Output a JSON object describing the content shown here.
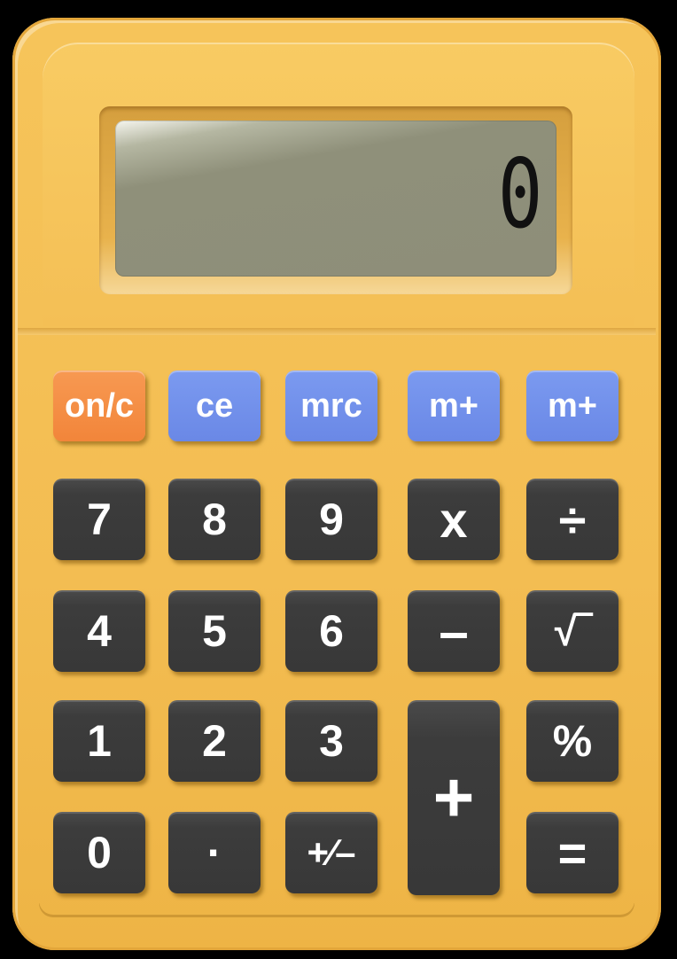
{
  "display": {
    "value": "0"
  },
  "function_keys": {
    "on_c": "on/c",
    "ce": "ce",
    "mrc": "mrc",
    "m_plus_1": "m+",
    "m_plus_2": "m+"
  },
  "keys": {
    "seven": "7",
    "eight": "8",
    "nine": "9",
    "multiply": "x",
    "divide": "÷",
    "four": "4",
    "five": "5",
    "six": "6",
    "minus": "–",
    "sqrt": "√‾",
    "one": "1",
    "two": "2",
    "three": "3",
    "plus": "+",
    "percent": "%",
    "zero": "0",
    "decimal": "·",
    "plus_minus": "+⁄–",
    "equals": "="
  },
  "colors": {
    "body": "#f4bf55",
    "display": "#8e8e79",
    "key_dark": "#3c3c3c",
    "key_blue": "#6a88e6",
    "key_orange": "#f2853a"
  }
}
